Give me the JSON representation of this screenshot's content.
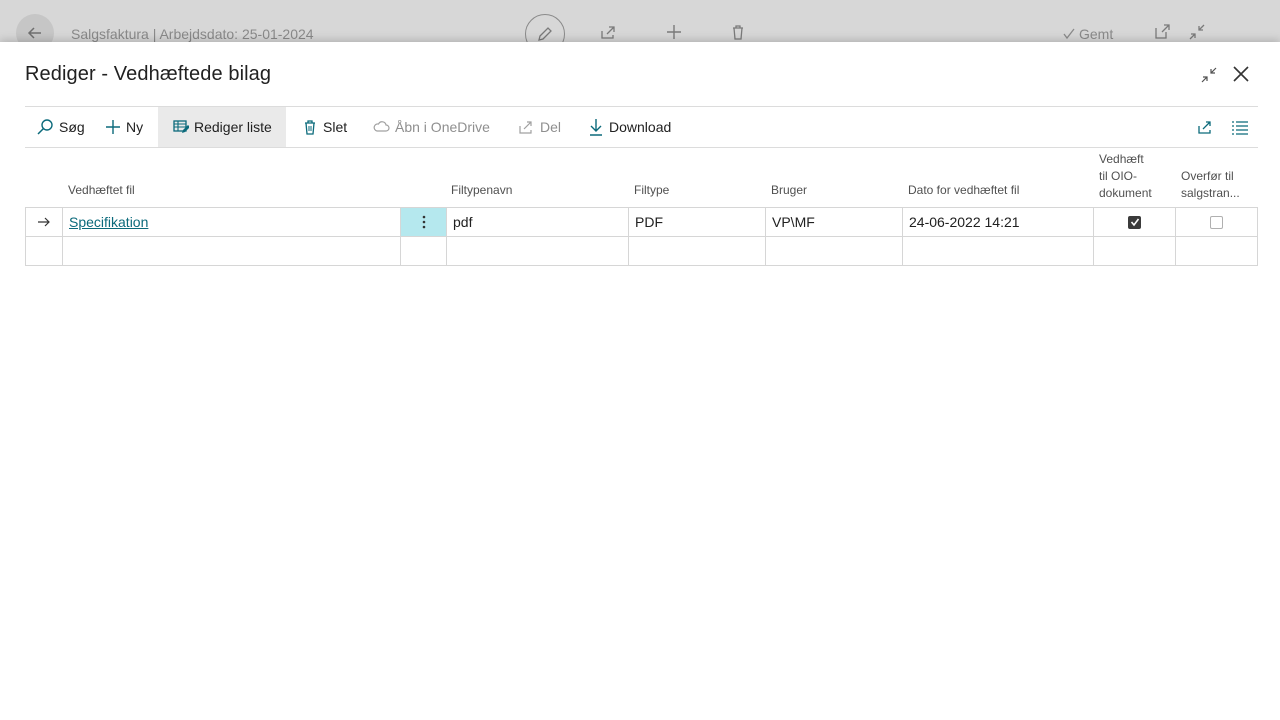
{
  "background": {
    "title": "Salgsfaktura | Arbejdsdato: 25-01-2024",
    "saved_label": "Gemt"
  },
  "dialog": {
    "title": "Rediger - Vedhæftede bilag"
  },
  "actions": [
    {
      "label": "Søg",
      "icon": "search-icon"
    },
    {
      "label": "Ny",
      "icon": "plus-icon"
    },
    {
      "label": "Rediger liste",
      "icon": "edit-list-icon",
      "active": true
    },
    {
      "label": "Slet",
      "icon": "trash-icon"
    },
    {
      "label": "Åbn i OneDrive",
      "icon": "cloud-icon",
      "disabled": true
    },
    {
      "label": "Del",
      "icon": "share-icon",
      "disabled": true
    },
    {
      "label": "Download",
      "icon": "download-icon"
    }
  ],
  "columns": {
    "file": "Vedhæftet fil",
    "ext": "Filtypenavn",
    "type": "Filtype",
    "user": "Bruger",
    "date": "Dato for vedhæftet fil",
    "oio_line1": "Vedhæft",
    "oio_line2": "til OIO-",
    "oio_line3": "dokument",
    "transfer_line1": "Overfør til",
    "transfer_line2": "salgstran..."
  },
  "rows": [
    {
      "file": "Specifikation",
      "ext": "pdf",
      "type": "PDF",
      "user": "VP\\MF",
      "date": "24-06-2022 14:21",
      "oio": true,
      "transfer": false
    }
  ],
  "colors": {
    "accent": "#0b6a7b",
    "selected_cell": "#b5e8ee"
  }
}
